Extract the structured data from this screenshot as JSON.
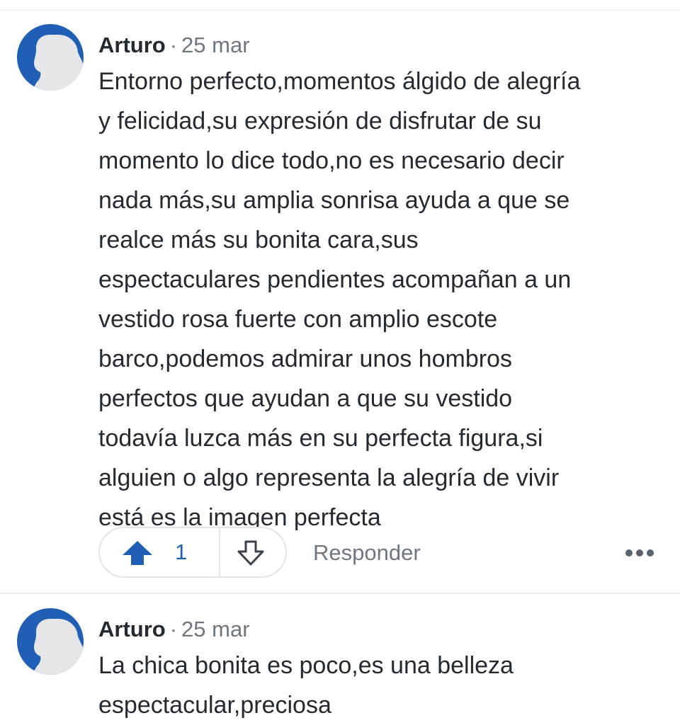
{
  "comments": [
    {
      "author": "Arturo",
      "separator": "·",
      "date": "25 mar",
      "text": "Entorno perfecto,momentos álgido de alegría\ny felicidad,su expresión de disfrutar de su\nmomento lo dice todo,no es necesario decir\nnada más,su amplia sonrisa ayuda a que se\nrealce más su bonita cara,sus\nespectaculares pendientes acompañan a un\nvestido rosa fuerte con amplio escote\nbarco,podemos admirar unos hombros\nperfectos que ayudan a que su vestido\ntodavía luzca más en su perfecta figura,si\nalguien o algo representa la alegría de vivir\nestá es la imagen perfecta",
      "upvotes": "1",
      "reply_label": "Responder",
      "avatar_icon": "default-profile-silhouette-icon"
    },
    {
      "author": "Arturo",
      "separator": "·",
      "date": "25 mar",
      "text": "La chica bonita es poco,es una belleza\nespectacular,preciosa",
      "avatar_icon": "default-profile-silhouette-icon"
    }
  ],
  "colors": {
    "accent": "#1f5fb5",
    "text": "#232a31",
    "muted": "#6e7780",
    "border": "#e3e5e7"
  },
  "icons": {
    "upvote": "arrow-up-filled-icon",
    "downvote": "arrow-down-outline-icon",
    "more": "more-horizontal-icon"
  }
}
